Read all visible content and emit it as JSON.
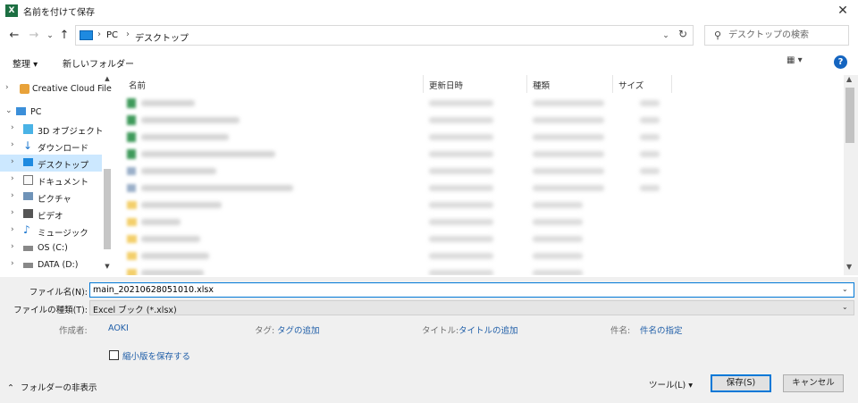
{
  "window": {
    "title": "名前を付けて保存",
    "app_icon": "X",
    "close_label": "✕"
  },
  "nav": {
    "back": "←",
    "forward": "→",
    "recent": "⌄",
    "up": "↑",
    "breadcrumb": [
      "PC",
      "デスクトップ"
    ],
    "dropdown": "⌄",
    "refresh": "↻",
    "search_placeholder": "デスクトップの検索"
  },
  "toolbar": {
    "organize": "整理 ▾",
    "new_folder": "新しいフォルダー",
    "view": "▦ ▾",
    "help": "?"
  },
  "sidebar": {
    "items": [
      {
        "label": "Creative Cloud File",
        "icon": "creative-cloud-icon"
      },
      {
        "label": "PC",
        "icon": "pc-icon"
      },
      {
        "label": "3D オブジェクト",
        "icon": "3d-objects-icon"
      },
      {
        "label": "ダウンロード",
        "icon": "download-icon"
      },
      {
        "label": "デスクトップ",
        "icon": "desktop-icon"
      },
      {
        "label": "ドキュメント",
        "icon": "document-icon"
      },
      {
        "label": "ピクチャ",
        "icon": "pictures-icon"
      },
      {
        "label": "ビデオ",
        "icon": "video-icon"
      },
      {
        "label": "ミュージック",
        "icon": "music-icon"
      },
      {
        "label": "OS (C:)",
        "icon": "drive-os-icon"
      },
      {
        "label": "DATA (D:)",
        "icon": "drive-icon"
      }
    ]
  },
  "file_list": {
    "columns": [
      "名前",
      "更新日時",
      "種類",
      "サイズ"
    ],
    "rows": [
      {
        "kind": "excel"
      },
      {
        "kind": "excel"
      },
      {
        "kind": "excel"
      },
      {
        "kind": "excel"
      },
      {
        "kind": "link"
      },
      {
        "kind": "link"
      },
      {
        "kind": "folder"
      },
      {
        "kind": "folder"
      },
      {
        "kind": "folder"
      },
      {
        "kind": "folder"
      },
      {
        "kind": "folder"
      },
      {
        "kind": "folder"
      }
    ]
  },
  "form": {
    "filename_label": "ファイル名(N):",
    "filename_value": "main_20210628051010.xlsx",
    "filetype_label": "ファイルの種類(T):",
    "filetype_value": "Excel ブック (*.xlsx)",
    "author_label": "作成者:",
    "author_value": "AOKI",
    "tags_label": "タグ:",
    "tags_value": "タグの追加",
    "title_label": "タイトル:",
    "title_value": "タイトルの追加",
    "subject_label": "件名:",
    "subject_value": "件名の指定",
    "thumbnail_label": "縮小版を保存する",
    "hide_folders": "フォルダーの非表示",
    "tools": "ツール(L)  ▾",
    "save": "保存(S)",
    "cancel": "キャンセル"
  },
  "colors": {
    "accent": "#0078d7",
    "selection": "#cce8ff",
    "excel_green": "#1d6f42",
    "link_blue": "#1f5ea8"
  }
}
